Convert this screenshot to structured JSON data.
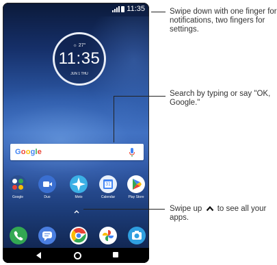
{
  "status_bar": {
    "time": "11:35"
  },
  "clock_widget": {
    "weather": "☼ 27°",
    "time": "11:35",
    "date": "JUN 1 THU"
  },
  "search_bar": {
    "logo": "Google"
  },
  "apps": [
    {
      "name": "Google",
      "label": "Google"
    },
    {
      "name": "Duo",
      "label": "Duo"
    },
    {
      "name": "Moto",
      "label": "Moto"
    },
    {
      "name": "Calendar",
      "label": "Calendar",
      "day": "31"
    },
    {
      "name": "Play Store",
      "label": "Play Store"
    }
  ],
  "dock": [
    "Phone",
    "Messages",
    "Chrome",
    "Photos",
    "Camera"
  ],
  "callouts": {
    "notifications": "Swipe down with one finger for notifications, two fingers for settings.",
    "search": "Search by typing or say \"OK, Google.\"",
    "apps_pre": "Swipe up",
    "apps_post": "to see all your apps."
  },
  "colors": {
    "google_blue": "#4285F4",
    "google_red": "#EA4335",
    "google_yellow": "#FBBC05",
    "google_green": "#34A853"
  }
}
